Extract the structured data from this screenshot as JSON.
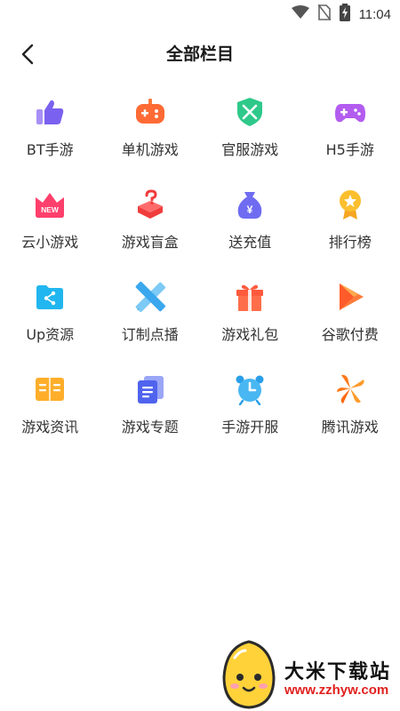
{
  "status": {
    "time": "11:04"
  },
  "header": {
    "title": "全部栏目"
  },
  "tiles": [
    {
      "label": "BT手游",
      "icon": "thumbs-up-icon"
    },
    {
      "label": "单机游戏",
      "icon": "gamepad-icon"
    },
    {
      "label": "官服游戏",
      "icon": "shield-swords-icon"
    },
    {
      "label": "H5手游",
      "icon": "game-controller-icon"
    },
    {
      "label": "云小游戏",
      "icon": "new-crown-icon",
      "badge": "NEW"
    },
    {
      "label": "游戏盲盒",
      "icon": "mystery-box-icon"
    },
    {
      "label": "送充值",
      "icon": "money-bag-icon",
      "symbol": "¥"
    },
    {
      "label": "排行榜",
      "icon": "medal-icon"
    },
    {
      "label": "Up资源",
      "icon": "shared-folder-icon"
    },
    {
      "label": "订制点播",
      "icon": "ruler-pencil-icon"
    },
    {
      "label": "游戏礼包",
      "icon": "gift-icon"
    },
    {
      "label": "谷歌付费",
      "icon": "play-store-icon"
    },
    {
      "label": "游戏资讯",
      "icon": "news-book-icon"
    },
    {
      "label": "游戏专题",
      "icon": "topic-pages-icon"
    },
    {
      "label": "手游开服",
      "icon": "alarm-clock-icon"
    },
    {
      "label": "腾讯游戏",
      "icon": "tencent-games-icon"
    }
  ],
  "watermark": {
    "name": "大米下载站",
    "url": "www.zzhyw.com"
  },
  "colors": {
    "accent": "#7b6cf6",
    "text": "#333333"
  }
}
